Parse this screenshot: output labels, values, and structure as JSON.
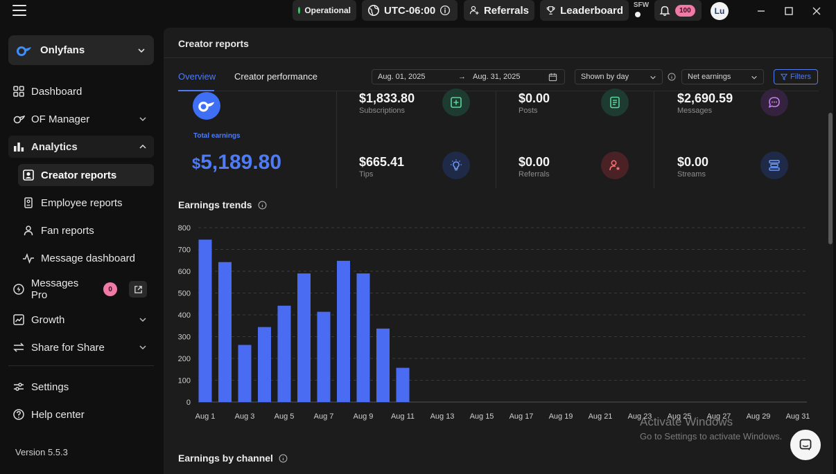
{
  "topbar": {
    "status": "Operational",
    "timezone": "UTC-06:00",
    "referrals": "Referrals",
    "leaderboard": "Leaderboard",
    "sfw": "SFW",
    "notifications_count": "100",
    "avatar_initials": "Lu"
  },
  "sidebar": {
    "workspace": "Onlyfans",
    "items": {
      "dashboard": "Dashboard",
      "of_manager": "OF Manager",
      "analytics": "Analytics",
      "creator_reports": "Creator reports",
      "employee_reports": "Employee reports",
      "fan_reports": "Fan reports",
      "message_dashboard": "Message dashboard",
      "messages_pro": "Messages Pro",
      "messages_pro_badge": "0",
      "growth": "Growth",
      "share_for_share": "Share for Share",
      "settings": "Settings",
      "help_center": "Help center"
    },
    "version": "Version 5.5.3"
  },
  "main": {
    "title": "Creator reports",
    "tabs": {
      "overview": "Overview",
      "creator_performance": "Creator performance"
    },
    "date_from": "Aug. 01, 2025",
    "date_to": "Aug. 31, 2025",
    "shown_by": "Shown by day",
    "metric": "Net earnings",
    "filters": "Filters",
    "total_label": "Total earnings",
    "total_currency": "$",
    "total_value": "5,189.80",
    "stats": {
      "subscriptions": {
        "value": "$1,833.80",
        "label": "Subscriptions"
      },
      "posts": {
        "value": "$0.00",
        "label": "Posts"
      },
      "messages": {
        "value": "$2,690.59",
        "label": "Messages"
      },
      "tips": {
        "value": "$665.41",
        "label": "Tips"
      },
      "referrals": {
        "value": "$0.00",
        "label": "Referrals"
      },
      "streams": {
        "value": "$0.00",
        "label": "Streams"
      }
    },
    "earnings_trends_title": "Earnings trends",
    "earnings_by_channel_title": "Earnings by channel"
  },
  "watermark": {
    "line1": "Activate Windows",
    "line2": "Go to Settings to activate Windows."
  },
  "colors": {
    "accent": "#4f7cf6",
    "bar": "#4a6cf3",
    "pink": "#f07aa6",
    "ok": "#43c46b"
  },
  "chart_data": {
    "type": "bar",
    "title": "Earnings trends",
    "categories": [
      "Aug 1",
      "Aug 2",
      "Aug 3",
      "Aug 4",
      "Aug 5",
      "Aug 6",
      "Aug 7",
      "Aug 8",
      "Aug 9",
      "Aug 10",
      "Aug 11",
      "Aug 12",
      "Aug 13",
      "Aug 14",
      "Aug 15",
      "Aug 16",
      "Aug 17",
      "Aug 18",
      "Aug 19",
      "Aug 20",
      "Aug 21",
      "Aug 22",
      "Aug 23",
      "Aug 24",
      "Aug 25",
      "Aug 26",
      "Aug 27",
      "Aug 28",
      "Aug 29",
      "Aug 30",
      "Aug 31"
    ],
    "x_tick_labels": [
      "Aug 1",
      "Aug 3",
      "Aug 5",
      "Aug 7",
      "Aug 9",
      "Aug 11",
      "Aug 13",
      "Aug 15",
      "Aug 17",
      "Aug 19",
      "Aug 21",
      "Aug 23",
      "Aug 25",
      "Aug 27",
      "Aug 29",
      "Aug 31"
    ],
    "values": [
      745,
      642,
      262,
      344,
      442,
      590,
      414,
      648,
      590,
      337,
      157,
      0,
      0,
      0,
      0,
      0,
      0,
      0,
      0,
      0,
      0,
      0,
      0,
      0,
      0,
      0,
      0,
      0,
      0,
      0,
      0
    ],
    "ylim": [
      0,
      800
    ],
    "yticks": [
      0,
      100,
      200,
      300,
      400,
      500,
      600,
      700,
      800
    ],
    "grid": true
  }
}
